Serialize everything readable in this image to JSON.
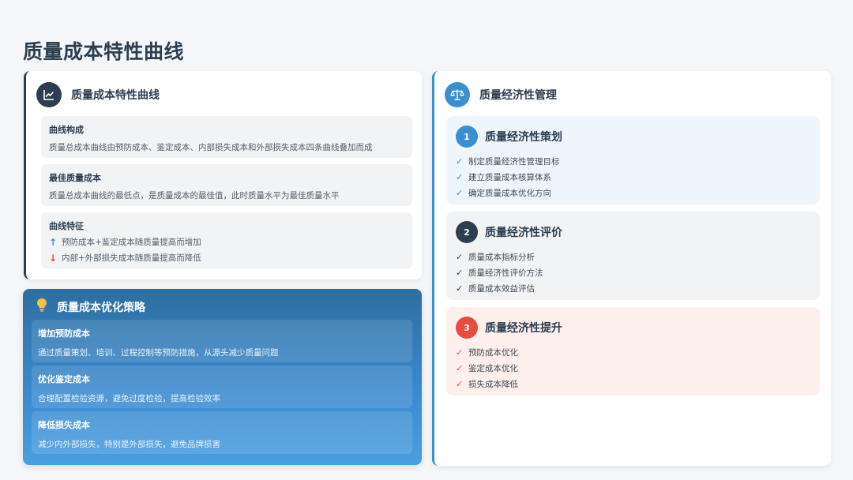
{
  "page_title": "质量成本特性曲线",
  "left_card": {
    "icon": "line-chart-icon",
    "title": "质量成本特性曲线",
    "boxes": [
      {
        "title": "曲线构成",
        "text": "质量总成本曲线由预防成本、鉴定成本、内部损失成本和外部损失成本四条曲线叠加而成"
      },
      {
        "title": "最佳质量成本",
        "text": "质量总成本曲线的最低点，是质量成本的最佳值，此时质量水平为最佳质量水平"
      }
    ],
    "features": {
      "title": "曲线特征",
      "up": "预防成本+鉴定成本随质量提高而增加",
      "down": "内部+外部损失成本随质量提高而降低"
    }
  },
  "strategy": {
    "icon": "lightbulb-icon",
    "title": "质量成本优化策略",
    "items": [
      {
        "title": "增加预防成本",
        "text": "通过质量策划、培训、过程控制等预防措施，从源头减少质量问题"
      },
      {
        "title": "优化鉴定成本",
        "text": "合理配置检验资源，避免过度检验，提高检验效率"
      },
      {
        "title": "降低损失成本",
        "text": "减少内外部损失，特别是外部损失，避免品牌损害"
      }
    ]
  },
  "right_card": {
    "icon": "balance-scale-icon",
    "title": "质量经济性管理",
    "sections": [
      {
        "num": "1",
        "title": "质量经济性策划",
        "items": [
          "制定质量经济性管理目标",
          "建立质量成本核算体系",
          "确定质量成本优化方向"
        ]
      },
      {
        "num": "2",
        "title": "质量经济性评价",
        "items": [
          "质量成本指标分析",
          "质量经济性评价方法",
          "质量成本效益评估"
        ]
      },
      {
        "num": "3",
        "title": "质量经济性提升",
        "items": [
          "预防成本优化",
          "鉴定成本优化",
          "损失成本降低"
        ]
      }
    ]
  },
  "colors": {
    "dark": "#2c3e50",
    "blue": "#3a8fd1",
    "red": "#e74c3c",
    "bulb": "#f6c23e"
  },
  "symbols": {
    "arrow_up": "↑",
    "arrow_down": "↓",
    "check": "✓"
  }
}
